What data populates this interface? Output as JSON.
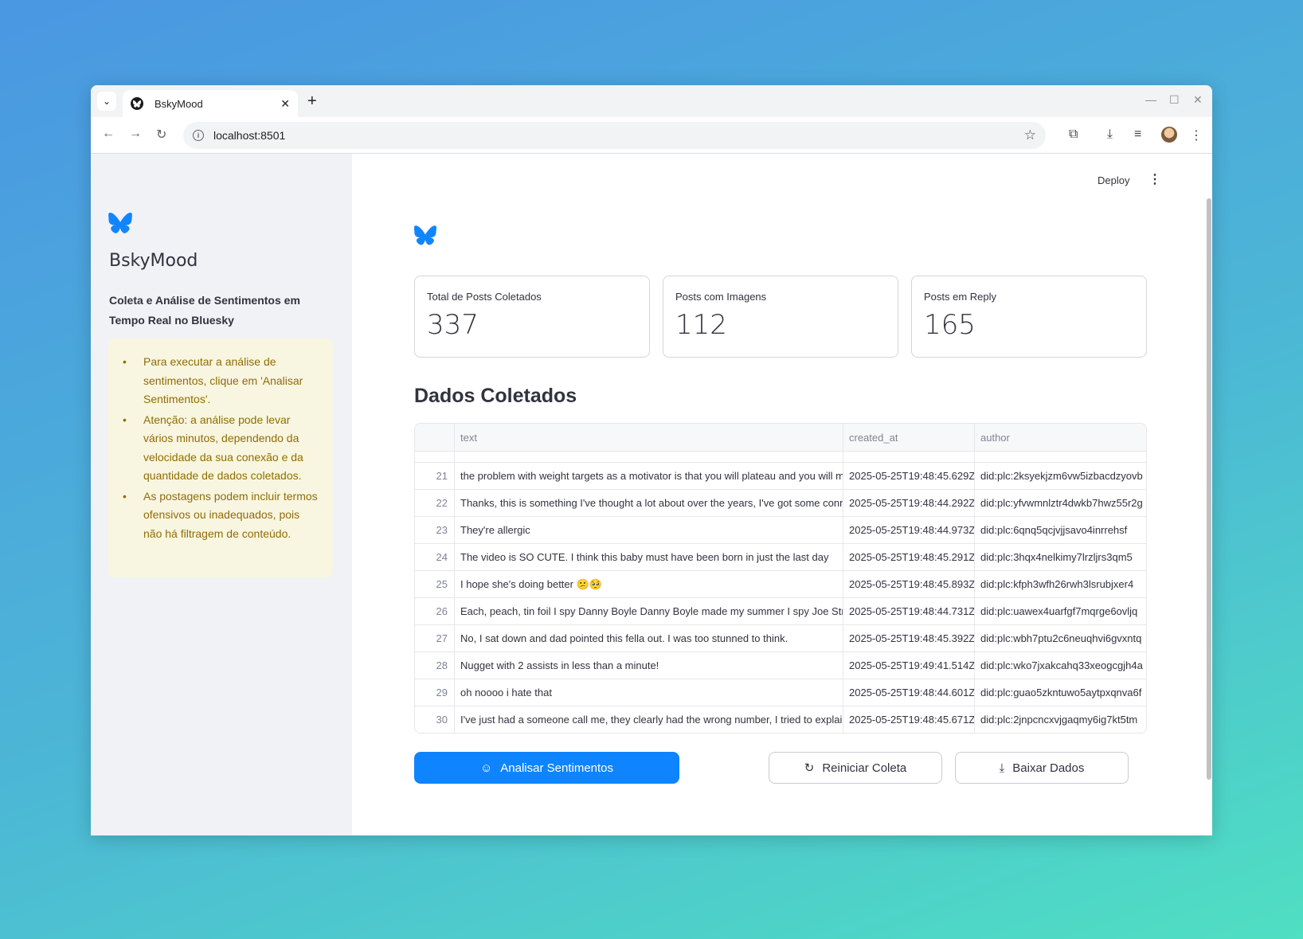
{
  "browser": {
    "tab_title": "BskyMood",
    "url": "localhost:8501",
    "tab_menu_icon": "chevron-down-icon",
    "new_tab_label": "+",
    "close_label": "✕"
  },
  "sidebar": {
    "logo": "butterfly-icon",
    "title": "BskyMood",
    "subtitle": "Coleta e Análise de Sentimentos em Tempo Real no Bluesky",
    "alert_items": [
      "Para executar a análise de sentimentos, clique em 'Analisar Sentimentos'.",
      "Atenção: a análise pode levar vários minutos, dependendo da velocidade da sua conexão e da quantidade de dados coletados.",
      "As postagens podem incluir termos ofensivos ou inadequados, pois não há filtragem de conteúdo."
    ]
  },
  "header": {
    "deploy_label": "Deploy"
  },
  "metrics": [
    {
      "label": "Total de Posts Coletados",
      "value": "337"
    },
    {
      "label": "Posts com Imagens",
      "value": "112"
    },
    {
      "label": "Posts em Reply",
      "value": "165"
    }
  ],
  "section_title": "Dados Coletados",
  "table": {
    "columns": [
      "",
      "text",
      "created_at",
      "author"
    ],
    "rows": [
      {
        "idx": "21",
        "text": "the problem with weight targets as a motivator is that you will plateau and you will m",
        "created_at": "2025-05-25T19:48:45.629Z",
        "author": "did:plc:2ksyekjzm6vw5izbacdzyovb"
      },
      {
        "idx": "22",
        "text": "Thanks, this is something I've thought a lot about over the years, I've got some conne",
        "created_at": "2025-05-25T19:48:44.292Z",
        "author": "did:plc:yfvwmnlztr4dwkb7hwz55r2g"
      },
      {
        "idx": "23",
        "text": "They're allergic",
        "created_at": "2025-05-25T19:48:44.973Z",
        "author": "did:plc:6qnq5qcjvjjsavo4inrrehsf"
      },
      {
        "idx": "24",
        "text": "The video is SO CUTE. I think this baby must have been born in just the last day",
        "created_at": "2025-05-25T19:48:45.291Z",
        "author": "did:plc:3hqx4nelkimy7lrzljrs3qm5"
      },
      {
        "idx": "25",
        "text": "I hope she's doing better 😕🥺",
        "created_at": "2025-05-25T19:48:45.893Z",
        "author": "did:plc:kfph3wfh26rwh3lsrubjxer4"
      },
      {
        "idx": "26",
        "text": "Each, peach, tin foil I spy Danny Boyle Danny Boyle made my summer I spy Joe Strum",
        "created_at": "2025-05-25T19:48:44.731Z",
        "author": "did:plc:uawex4uarfgf7mqrge6ovljq"
      },
      {
        "idx": "27",
        "text": "No, I sat down and dad pointed this fella out. I was too stunned to think.",
        "created_at": "2025-05-25T19:48:45.392Z",
        "author": "did:plc:wbh7ptu2c6neuqhvi6gvxntq"
      },
      {
        "idx": "28",
        "text": "Nugget with 2 assists in less than a minute!",
        "created_at": "2025-05-25T19:49:41.514Z",
        "author": "did:plc:wko7jxakcahq33xeogcgjh4a"
      },
      {
        "idx": "29",
        "text": "oh noooo i hate that",
        "created_at": "2025-05-25T19:48:44.601Z",
        "author": "did:plc:guao5zkntuwo5aytpxqnva6f"
      },
      {
        "idx": "30",
        "text": "I've just had a someone call me, they clearly had the wrong number, I tried to explain",
        "created_at": "2025-05-25T19:48:45.671Z",
        "author": "did:plc:2jnpcncxvjgaqmy6ig7kt5tm"
      }
    ]
  },
  "buttons": {
    "analyze": "Analisar Sentimentos",
    "restart": "Reiniciar Coleta",
    "download": "Baixar Dados"
  },
  "colors": {
    "primary": "#0e84ff",
    "sidebar_bg": "#f0f2f6",
    "alert_bg": "#f8f6e0",
    "alert_text": "#926c05",
    "bluesky_blue": "#1185fe"
  }
}
